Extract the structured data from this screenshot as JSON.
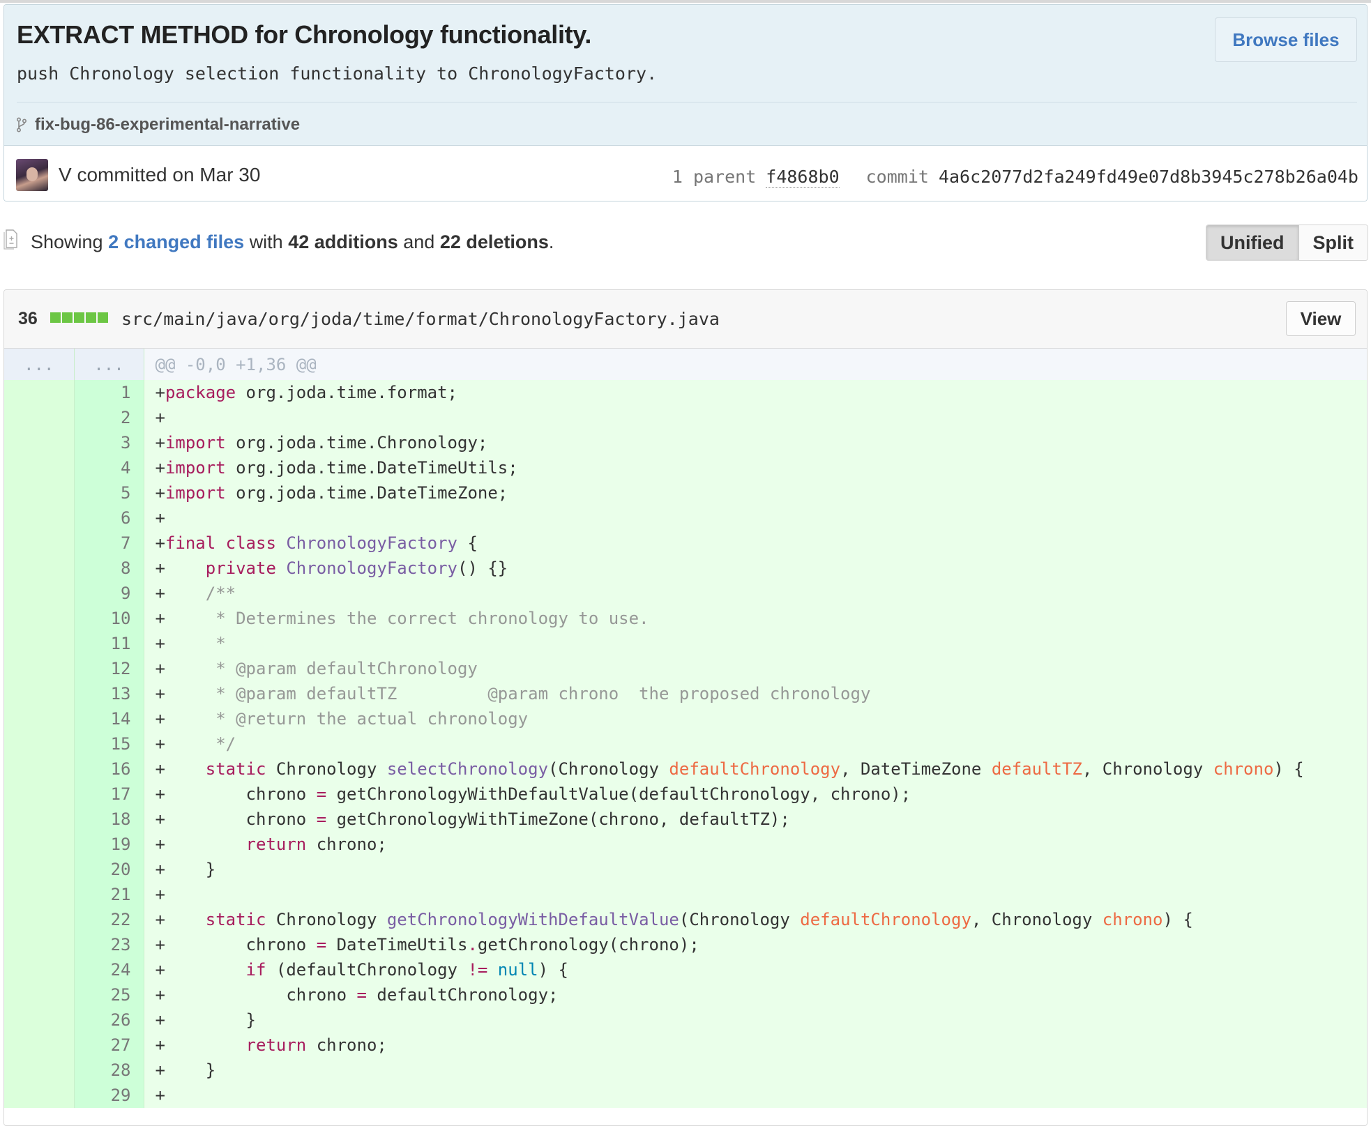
{
  "commit": {
    "title": "EXTRACT METHOD for Chronology functionality.",
    "description": "push Chronology selection functionality to ChronologyFactory.",
    "browse_files_label": "Browse files",
    "branch": "fix-bug-86-experimental-narrative",
    "author_line": "V committed on Mar 30",
    "parent_label": "1 parent",
    "parent_sha": "f4868b0",
    "commit_label": "commit",
    "commit_sha": "4a6c2077d2fa249fd49e07d8b3945c278b26a04b"
  },
  "toc": {
    "showing": "Showing",
    "changed_files": "2 changed files",
    "with": "with",
    "additions": "42 additions",
    "and": "and",
    "deletions": "22 deletions",
    "period": "."
  },
  "view_toggle": {
    "unified": "Unified",
    "split": "Split",
    "selected": "unified"
  },
  "file": {
    "change_count": "36",
    "diffstat_blocks": [
      "added",
      "added",
      "added",
      "added",
      "added"
    ],
    "path": "src/main/java/org/joda/time/format/ChronologyFactory.java",
    "view_label": "View",
    "hunk": {
      "old_marker": "...",
      "new_marker": "...",
      "header": "@@ -0,0 +1,36 @@"
    },
    "lines": [
      {
        "n": "1",
        "t": [
          [
            "p",
            "+"
          ],
          [
            "kw",
            "package"
          ],
          [
            "p",
            " org.joda.time.format;"
          ]
        ]
      },
      {
        "n": "2",
        "t": [
          [
            "p",
            "+"
          ]
        ]
      },
      {
        "n": "3",
        "t": [
          [
            "p",
            "+"
          ],
          [
            "kw",
            "import"
          ],
          [
            "p",
            " org.joda.time.Chronology;"
          ]
        ]
      },
      {
        "n": "4",
        "t": [
          [
            "p",
            "+"
          ],
          [
            "kw",
            "import"
          ],
          [
            "p",
            " org.joda.time.DateTimeUtils;"
          ]
        ]
      },
      {
        "n": "5",
        "t": [
          [
            "p",
            "+"
          ],
          [
            "kw",
            "import"
          ],
          [
            "p",
            " org.joda.time.DateTimeZone;"
          ]
        ]
      },
      {
        "n": "6",
        "t": [
          [
            "p",
            "+"
          ]
        ]
      },
      {
        "n": "7",
        "t": [
          [
            "p",
            "+"
          ],
          [
            "kw",
            "final"
          ],
          [
            "p",
            " "
          ],
          [
            "kw",
            "class"
          ],
          [
            "p",
            " "
          ],
          [
            "cls",
            "ChronologyFactory"
          ],
          [
            "p",
            " {"
          ]
        ]
      },
      {
        "n": "8",
        "t": [
          [
            "p",
            "+    "
          ],
          [
            "kw",
            "private"
          ],
          [
            "p",
            " "
          ],
          [
            "fn",
            "ChronologyFactory"
          ],
          [
            "p",
            "() {}"
          ]
        ]
      },
      {
        "n": "9",
        "t": [
          [
            "p",
            "+    "
          ],
          [
            "cmt",
            "/**"
          ]
        ]
      },
      {
        "n": "10",
        "t": [
          [
            "p",
            "+     "
          ],
          [
            "cmt",
            "* Determines the correct chronology to use."
          ]
        ]
      },
      {
        "n": "11",
        "t": [
          [
            "p",
            "+     "
          ],
          [
            "cmt",
            "*"
          ]
        ]
      },
      {
        "n": "12",
        "t": [
          [
            "p",
            "+     "
          ],
          [
            "cmt",
            "* @param defaultChronology"
          ]
        ]
      },
      {
        "n": "13",
        "t": [
          [
            "p",
            "+     "
          ],
          [
            "cmt",
            "* @param defaultTZ         @param chrono  the proposed chronology"
          ]
        ]
      },
      {
        "n": "14",
        "t": [
          [
            "p",
            "+     "
          ],
          [
            "cmt",
            "* @return the actual chronology"
          ]
        ]
      },
      {
        "n": "15",
        "t": [
          [
            "p",
            "+     "
          ],
          [
            "cmt",
            "*/"
          ]
        ]
      },
      {
        "n": "16",
        "t": [
          [
            "p",
            "+    "
          ],
          [
            "kw",
            "static"
          ],
          [
            "p",
            " Chronology "
          ],
          [
            "fn",
            "selectChronology"
          ],
          [
            "p",
            "(Chronology "
          ],
          [
            "prm",
            "defaultChronology"
          ],
          [
            "p",
            ", DateTimeZone "
          ],
          [
            "prm",
            "defaultTZ"
          ],
          [
            "p",
            ", Chronology "
          ],
          [
            "prm",
            "chrono"
          ],
          [
            "p",
            ") {"
          ]
        ]
      },
      {
        "n": "17",
        "t": [
          [
            "p",
            "+        chrono "
          ],
          [
            "kw",
            "="
          ],
          [
            "p",
            " getChronologyWithDefaultValue(defaultChronology, chrono);"
          ]
        ]
      },
      {
        "n": "18",
        "t": [
          [
            "p",
            "+        chrono "
          ],
          [
            "kw",
            "="
          ],
          [
            "p",
            " getChronologyWithTimeZone(chrono, defaultTZ);"
          ]
        ]
      },
      {
        "n": "19",
        "t": [
          [
            "p",
            "+        "
          ],
          [
            "kw",
            "return"
          ],
          [
            "p",
            " chrono;"
          ]
        ]
      },
      {
        "n": "20",
        "t": [
          [
            "p",
            "+    }"
          ]
        ]
      },
      {
        "n": "21",
        "t": [
          [
            "p",
            "+"
          ]
        ]
      },
      {
        "n": "22",
        "t": [
          [
            "p",
            "+    "
          ],
          [
            "kw",
            "static"
          ],
          [
            "p",
            " Chronology "
          ],
          [
            "fn",
            "getChronologyWithDefaultValue"
          ],
          [
            "p",
            "(Chronology "
          ],
          [
            "prm",
            "defaultChronology"
          ],
          [
            "p",
            ", Chronology "
          ],
          [
            "prm",
            "chrono"
          ],
          [
            "p",
            ") {"
          ]
        ]
      },
      {
        "n": "23",
        "t": [
          [
            "p",
            "+        chrono "
          ],
          [
            "kw",
            "="
          ],
          [
            "p",
            " DateTimeUtils"
          ],
          [
            "kw",
            "."
          ],
          [
            "p",
            "getChronology(chrono);"
          ]
        ]
      },
      {
        "n": "24",
        "t": [
          [
            "p",
            "+        "
          ],
          [
            "kw",
            "if"
          ],
          [
            "p",
            " (defaultChronology "
          ],
          [
            "kw",
            "!="
          ],
          [
            "p",
            " "
          ],
          [
            "lit",
            "null"
          ],
          [
            "p",
            ") {"
          ]
        ]
      },
      {
        "n": "25",
        "t": [
          [
            "p",
            "+            chrono "
          ],
          [
            "kw",
            "="
          ],
          [
            "p",
            " defaultChronology;"
          ]
        ]
      },
      {
        "n": "26",
        "t": [
          [
            "p",
            "+        }"
          ]
        ]
      },
      {
        "n": "27",
        "t": [
          [
            "p",
            "+        "
          ],
          [
            "kw",
            "return"
          ],
          [
            "p",
            " chrono;"
          ]
        ]
      },
      {
        "n": "28",
        "t": [
          [
            "p",
            "+    }"
          ]
        ]
      },
      {
        "n": "29",
        "t": [
          [
            "p",
            "+"
          ]
        ]
      }
    ]
  },
  "icons": {
    "branch": "git-branch-icon",
    "diff": "file-diff-icon"
  },
  "colors": {
    "link": "#4078c0",
    "header_bg": "#e6f1f6",
    "added_bg": "#eaffea",
    "added_num_bg": "#cdffd8",
    "diffstat_add": "#6cc644",
    "keyword": "#a71d5d",
    "entity": "#795da3",
    "parameter": "#ed6a43",
    "comment": "#969896",
    "constant": "#0086b3"
  }
}
